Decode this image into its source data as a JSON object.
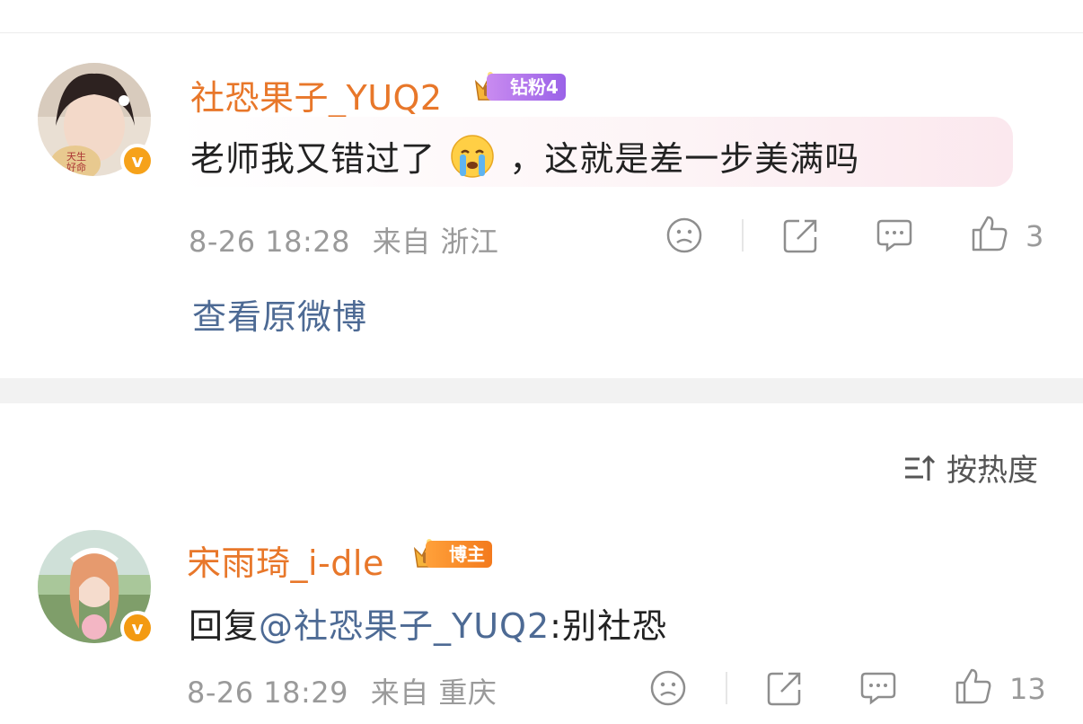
{
  "comment1": {
    "username": "社恐果子_YUQ2",
    "badge_label": "钻粉4",
    "text_before": "老师我又错过了",
    "emoji": "crying-face",
    "text_after": "，这就是差一步美满吗",
    "date": "8-26 18:28",
    "from": "来自 浙江",
    "likes": "3",
    "view_link": "查看原微博",
    "badge_color": "#a36cea"
  },
  "sort": {
    "label": "按热度"
  },
  "comment2": {
    "username": "宋雨琦_i-dle",
    "badge_label": "博主",
    "reply_prefix": "回复",
    "mention": "@社恐果子_YUQ2",
    "reply_text": ":别社恐",
    "date": "8-26 18:29",
    "from": "来自 重庆",
    "likes": "13",
    "badge_color": "#f37a1d"
  },
  "colors": {
    "username": "#e8772a",
    "link": "#4d6a94",
    "meta": "#9a9a9a"
  }
}
